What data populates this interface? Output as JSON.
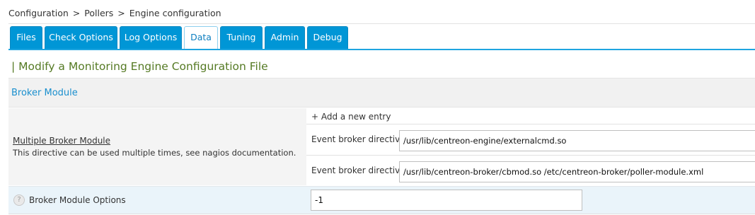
{
  "breadcrumb": {
    "items": [
      "Configuration",
      "Pollers",
      "Engine configuration"
    ],
    "separator": ">"
  },
  "tabs": [
    {
      "label": "Files"
    },
    {
      "label": "Check Options"
    },
    {
      "label": "Log Options"
    },
    {
      "label": "Data",
      "active": true
    },
    {
      "label": "Tuning"
    },
    {
      "label": "Admin"
    },
    {
      "label": "Debug"
    }
  ],
  "page_title": "| Modify a Monitoring Engine Configuration File",
  "section": {
    "title": "Broker Module"
  },
  "multiple_broker": {
    "label": "Multiple Broker Module",
    "description": "This directive can be used multiple times, see nagios documentation.",
    "add_entry": "+ Add a new entry",
    "entries": [
      {
        "label": "Event broker directive",
        "value": "/usr/lib/centreon-engine/externalcmd.so"
      },
      {
        "label": "Event broker directive",
        "value": "/usr/lib/centreon-broker/cbmod.so /etc/centreon-broker/poller-module.xml"
      }
    ]
  },
  "broker_options": {
    "help_icon": "question-circle-icon",
    "help_glyph": "?",
    "label": "Broker Module Options",
    "value": "-1"
  },
  "colors": {
    "tab": "#0096d6",
    "title": "#557a24",
    "section_title": "#1a8fce"
  }
}
